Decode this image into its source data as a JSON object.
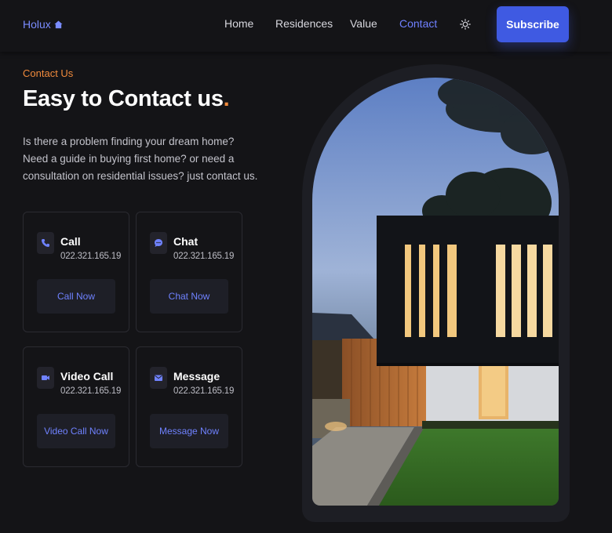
{
  "header": {
    "logo": "Holux",
    "nav": [
      "Home",
      "Residences",
      "Value",
      "Contact"
    ],
    "active_nav": "Contact",
    "subscribe_label": "Subscribe"
  },
  "contact": {
    "eyebrow": "Contact Us",
    "headline": "Easy to Contact us",
    "headline_dot": ".",
    "description": "Is there a problem finding your dream home? Need a guide in buying first home? or need a consultation on residential issues? just contact us."
  },
  "cards": [
    {
      "title": "Call",
      "number": "022.321.165.19",
      "button": "Call Now",
      "icon": "phone-icon"
    },
    {
      "title": "Chat",
      "number": "022.321.165.19",
      "button": "Chat Now",
      "icon": "chat-icon"
    },
    {
      "title": "Video Call",
      "number": "022.321.165.19",
      "button": "Video Call Now",
      "icon": "video-icon"
    },
    {
      "title": "Message",
      "number": "022.321.165.19",
      "button": "Message Now",
      "icon": "mail-icon"
    }
  ],
  "colors": {
    "background": "#141417",
    "accent": "#3f5ae2",
    "link": "#6f80ff",
    "orange": "#f08a3c"
  }
}
